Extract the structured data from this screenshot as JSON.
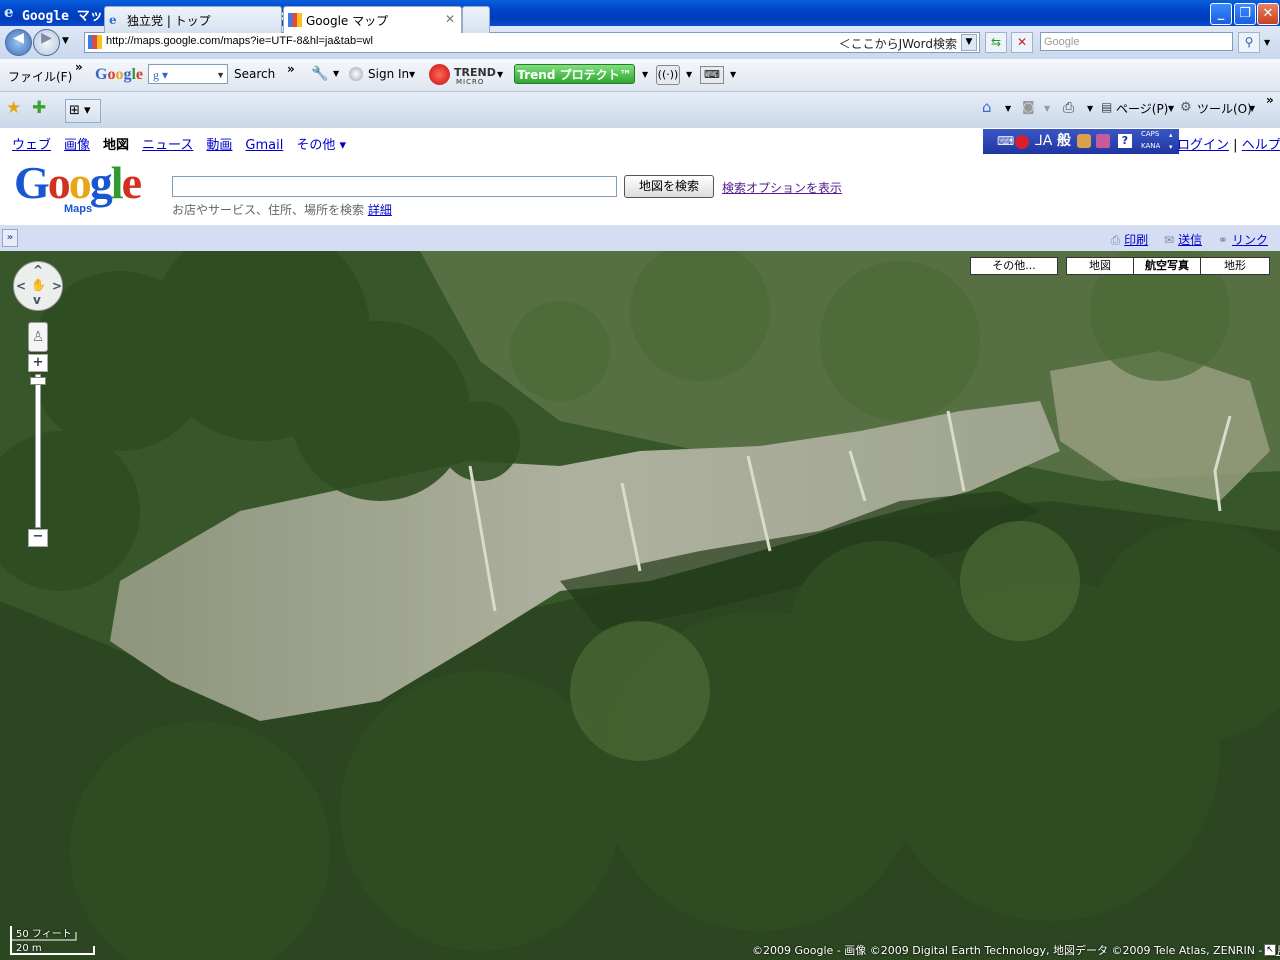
{
  "window": {
    "title": "Google マップ - Windows Internet Explorer",
    "minimize": "_",
    "maximize": "❐",
    "close": "✕"
  },
  "address_bar": {
    "url": "http://maps.google.com/maps?ie=UTF-8&hl=ja&tab=wl",
    "jword": "＜ここからJWord検索",
    "search_placeholder": "Google"
  },
  "menu_toolbar": {
    "file_menu": "ファイル(F)",
    "google_toolbar_search": "Search",
    "sign_in": "Sign In",
    "trend_label": "TREND",
    "trend_sub": "MICRO",
    "trend_protect": "Trend プロテクト™"
  },
  "tabs": [
    {
      "label": "独立党 | トップ",
      "active": false
    },
    {
      "label": "Google マップ",
      "active": true
    }
  ],
  "command_bar": {
    "page": "ページ(P)",
    "tools": "ツール(O)"
  },
  "google_nav": {
    "items": [
      {
        "label": "ウェブ",
        "current": false
      },
      {
        "label": "画像",
        "current": false
      },
      {
        "label": "地図",
        "current": true
      },
      {
        "label": "ニュース",
        "current": false
      },
      {
        "label": "動画",
        "current": false
      },
      {
        "label": "Gmail",
        "current": false
      },
      {
        "label": "その他 ▾",
        "current": false
      }
    ],
    "login": "ログイン",
    "separator": "|",
    "help": "ヘルプ"
  },
  "ime_bar": {
    "label": "般",
    "caps": "CAPS",
    "kana": "KANA"
  },
  "search": {
    "logo_letters": [
      "G",
      "o",
      "o",
      "g",
      "l",
      "e"
    ],
    "maps_label": "Maps",
    "query": "",
    "button": "地図を検索",
    "options_link": "検索オプションを表示",
    "hint": "お店やサービス、住所、場所を検索",
    "hint_link": "詳細"
  },
  "side_panel": {
    "toggle": "»"
  },
  "links_bar": {
    "print": "印刷",
    "send": "送信",
    "link": "リンク"
  },
  "map": {
    "type_buttons": [
      {
        "label": "その他...",
        "selected": false
      },
      {
        "label": "地図",
        "selected": false
      },
      {
        "label": "航空写真",
        "selected": true
      },
      {
        "label": "地形",
        "selected": false
      }
    ],
    "zoom_plus": "+",
    "zoom_minus": "−",
    "zoom_level_fraction": 0.02,
    "scale_feet": "50 フィート",
    "scale_meters": "20 m",
    "copyright": "©2009 Google - 画像 ©2009 Digital Earth Technology, 地図データ ©2009 Tele Atlas, ZENRIN -",
    "terms_link": "利用規約"
  },
  "colors": {
    "title_bar": "#0044c8",
    "link": "#0000cc",
    "visited_link": "#551a8b",
    "band": "#d5ddf3",
    "forest_dark": "#2a4a1f",
    "forest_light": "#5b7b45",
    "clearing": "#a9ac98"
  }
}
